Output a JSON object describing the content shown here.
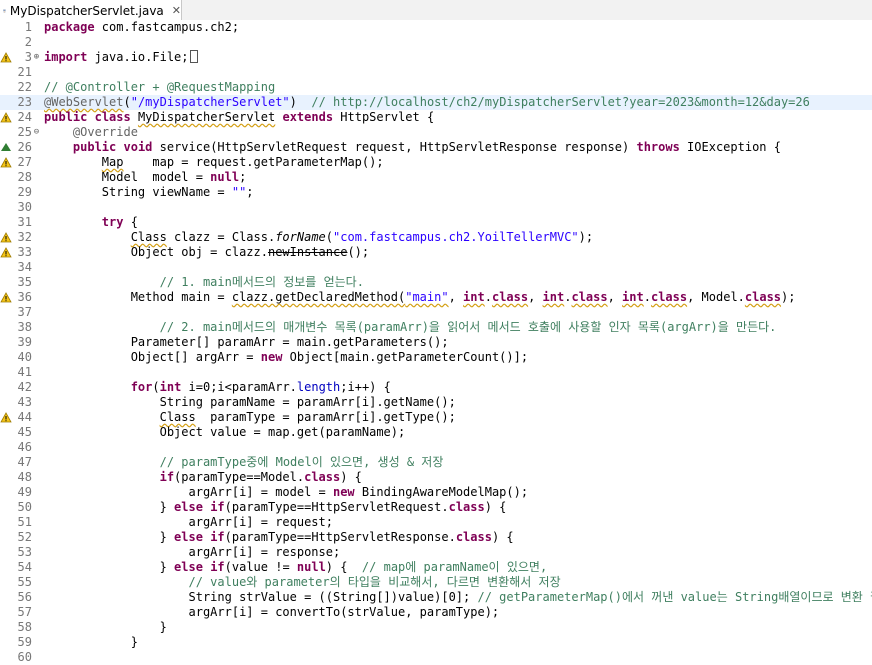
{
  "tab": {
    "title": "MyDispatcherServlet.java",
    "close": "✕"
  },
  "lines": [
    {
      "n": "1",
      "t": [
        [
          "package",
          "k"
        ],
        [
          " com.fastcampus.ch2;",
          ""
        ]
      ]
    },
    {
      "n": "2",
      "t": []
    },
    {
      "n": "3",
      "fold": "⊕",
      "marker": "warn",
      "t": [
        [
          "import",
          "k"
        ],
        [
          " java.io.File;",
          ""
        ],
        [
          "BOX",
          ""
        ]
      ]
    },
    {
      "n": "21",
      "t": []
    },
    {
      "n": "22",
      "t": [
        [
          "// @Controller + @RequestMapping",
          "c"
        ]
      ]
    },
    {
      "n": "23",
      "t": [
        [
          "@WebServlet",
          "a u"
        ],
        [
          "(",
          ""
        ],
        [
          "\"/myDispatcherServlet\"",
          "s"
        ],
        [
          ")  ",
          ""
        ],
        [
          "// http://localhost/ch2/myDispatcherServlet?year=2023&month=12&day=26",
          "c"
        ]
      ]
    },
    {
      "n": "24",
      "marker": "warn",
      "t": [
        [
          "public",
          "k"
        ],
        [
          " ",
          ""
        ],
        [
          "class",
          "k"
        ],
        [
          " ",
          ""
        ],
        [
          "MyDispatcherServlet",
          "u"
        ],
        [
          " ",
          ""
        ],
        [
          "extends",
          "k"
        ],
        [
          " HttpServlet {",
          ""
        ]
      ]
    },
    {
      "n": "25",
      "fold": "⊖",
      "t": [
        [
          "    ",
          ""
        ],
        [
          "@Override",
          "a"
        ]
      ]
    },
    {
      "n": "26",
      "marker": "over",
      "t": [
        [
          "    ",
          ""
        ],
        [
          "public",
          "k"
        ],
        [
          " ",
          ""
        ],
        [
          "void",
          "k"
        ],
        [
          " service(HttpServletRequest request, HttpServletResponse response) ",
          ""
        ],
        [
          "throws",
          "k"
        ],
        [
          " IOException {",
          ""
        ]
      ]
    },
    {
      "n": "27",
      "marker": "warn",
      "t": [
        [
          "        ",
          ""
        ],
        [
          "Map",
          "u"
        ],
        [
          "    map = request.getParameterMap();",
          ""
        ]
      ]
    },
    {
      "n": "28",
      "t": [
        [
          "        Model  model = ",
          ""
        ],
        [
          "null",
          "k"
        ],
        [
          ";",
          ""
        ]
      ]
    },
    {
      "n": "29",
      "t": [
        [
          "        String viewName = ",
          ""
        ],
        [
          "\"\"",
          "s"
        ],
        [
          ";",
          ""
        ]
      ]
    },
    {
      "n": "30",
      "t": []
    },
    {
      "n": "31",
      "t": [
        [
          "        ",
          ""
        ],
        [
          "try",
          "k"
        ],
        [
          " {",
          ""
        ]
      ]
    },
    {
      "n": "32",
      "marker": "warn",
      "t": [
        [
          "            ",
          ""
        ],
        [
          "Class",
          "u"
        ],
        [
          " clazz = Class.",
          ""
        ],
        [
          "forName",
          "i"
        ],
        [
          "(",
          ""
        ],
        [
          "\"com.fastcampus.ch2.YoilTellerMVC\"",
          "s"
        ],
        [
          ");",
          ""
        ]
      ]
    },
    {
      "n": "33",
      "marker": "warn",
      "t": [
        [
          "            Object obj = clazz.",
          ""
        ],
        [
          "newInstance",
          "st"
        ],
        [
          "();",
          ""
        ]
      ]
    },
    {
      "n": "34",
      "t": []
    },
    {
      "n": "35",
      "t": [
        [
          "                ",
          ""
        ],
        [
          "// 1. main메서드의 정보를 얻는다.",
          "c"
        ]
      ]
    },
    {
      "n": "36",
      "marker": "warn",
      "t": [
        [
          "            Method main = ",
          ""
        ],
        [
          "clazz.getDeclaredMethod(",
          "u"
        ],
        [
          "\"main\"",
          "s u"
        ],
        [
          ", ",
          ""
        ],
        [
          "int",
          "k u"
        ],
        [
          ".",
          ""
        ],
        [
          "class",
          "k u"
        ],
        [
          ", ",
          ""
        ],
        [
          "int",
          "k u"
        ],
        [
          ".",
          ""
        ],
        [
          "class",
          "k u"
        ],
        [
          ", ",
          ""
        ],
        [
          "int",
          "k u"
        ],
        [
          ".",
          ""
        ],
        [
          "class",
          "k u"
        ],
        [
          ", Model.",
          ""
        ],
        [
          "class",
          "k u"
        ],
        [
          ");",
          ""
        ]
      ]
    },
    {
      "n": "37",
      "t": []
    },
    {
      "n": "38",
      "t": [
        [
          "                ",
          ""
        ],
        [
          "// 2. main메서드의 매개변수 목록(paramArr)을 읽어서 메서드 호출에 사용할 인자 목록(argArr)을 만든다.",
          "c"
        ]
      ]
    },
    {
      "n": "39",
      "t": [
        [
          "            Parameter[] paramArr = main.getParameters();",
          ""
        ]
      ]
    },
    {
      "n": "40",
      "t": [
        [
          "            Object[] argArr = ",
          ""
        ],
        [
          "new",
          "k"
        ],
        [
          " Object[main.getParameterCount()];",
          ""
        ]
      ]
    },
    {
      "n": "41",
      "t": []
    },
    {
      "n": "42",
      "t": [
        [
          "            ",
          ""
        ],
        [
          "for",
          "k"
        ],
        [
          "(",
          ""
        ],
        [
          "int",
          "k"
        ],
        [
          " i=0;i<paramArr.",
          ""
        ],
        [
          "length",
          "f"
        ],
        [
          ";i++) {",
          ""
        ]
      ]
    },
    {
      "n": "43",
      "t": [
        [
          "                String paramName = paramArr[i].getName();",
          ""
        ]
      ]
    },
    {
      "n": "44",
      "marker": "warn",
      "t": [
        [
          "                ",
          ""
        ],
        [
          "Class",
          "u"
        ],
        [
          "  paramType = paramArr[i].getType();",
          ""
        ]
      ]
    },
    {
      "n": "45",
      "t": [
        [
          "                Object value = map.get(paramName);",
          ""
        ]
      ]
    },
    {
      "n": "46",
      "t": []
    },
    {
      "n": "47",
      "t": [
        [
          "                ",
          ""
        ],
        [
          "// paramType중에 Model이 있으면, 생성 & 저장",
          "c"
        ]
      ]
    },
    {
      "n": "48",
      "t": [
        [
          "                ",
          ""
        ],
        [
          "if",
          "k"
        ],
        [
          "(paramType==Model.",
          ""
        ],
        [
          "class",
          "k"
        ],
        [
          ") {",
          ""
        ]
      ]
    },
    {
      "n": "49",
      "t": [
        [
          "                    argArr[i] = model = ",
          ""
        ],
        [
          "new",
          "k"
        ],
        [
          " BindingAwareModelMap();",
          ""
        ]
      ]
    },
    {
      "n": "50",
      "t": [
        [
          "                } ",
          ""
        ],
        [
          "else",
          "k"
        ],
        [
          " ",
          ""
        ],
        [
          "if",
          "k"
        ],
        [
          "(paramType==HttpServletRequest.",
          ""
        ],
        [
          "class",
          "k"
        ],
        [
          ") {",
          ""
        ]
      ]
    },
    {
      "n": "51",
      "t": [
        [
          "                    argArr[i] = request;",
          ""
        ]
      ]
    },
    {
      "n": "52",
      "t": [
        [
          "                } ",
          ""
        ],
        [
          "else",
          "k"
        ],
        [
          " ",
          ""
        ],
        [
          "if",
          "k"
        ],
        [
          "(paramType==HttpServletResponse.",
          ""
        ],
        [
          "class",
          "k"
        ],
        [
          ") {",
          ""
        ]
      ]
    },
    {
      "n": "53",
      "t": [
        [
          "                    argArr[i] = response;",
          ""
        ]
      ]
    },
    {
      "n": "54",
      "t": [
        [
          "                } ",
          ""
        ],
        [
          "else",
          "k"
        ],
        [
          " ",
          ""
        ],
        [
          "if",
          "k"
        ],
        [
          "(value != ",
          ""
        ],
        [
          "null",
          "k"
        ],
        [
          ") {  ",
          ""
        ],
        [
          "// map에 paramName이 있으면,",
          "c"
        ]
      ]
    },
    {
      "n": "55",
      "t": [
        [
          "                    ",
          ""
        ],
        [
          "// value와 parameter의 타입을 비교해서, 다르면 변환해서 저장",
          "c"
        ]
      ]
    },
    {
      "n": "56",
      "t": [
        [
          "                    String strValue = ((String[])value)[0]; ",
          ""
        ],
        [
          "// getParameterMap()에서 꺼낸 value는 String배열이므로 변환 필요",
          "c"
        ]
      ]
    },
    {
      "n": "57",
      "t": [
        [
          "                    argArr[i] = convertTo(strValue, paramType);",
          ""
        ]
      ]
    },
    {
      "n": "58",
      "t": [
        [
          "                }",
          ""
        ]
      ]
    },
    {
      "n": "59",
      "t": [
        [
          "            }",
          ""
        ]
      ]
    },
    {
      "n": "60",
      "t": []
    }
  ],
  "colors": {
    "keyword": "#7f0055",
    "comment": "#3f7f5f",
    "string": "#2a00ff",
    "annotation": "#646464",
    "field": "#0000c0",
    "lineNumber": "#787878"
  }
}
